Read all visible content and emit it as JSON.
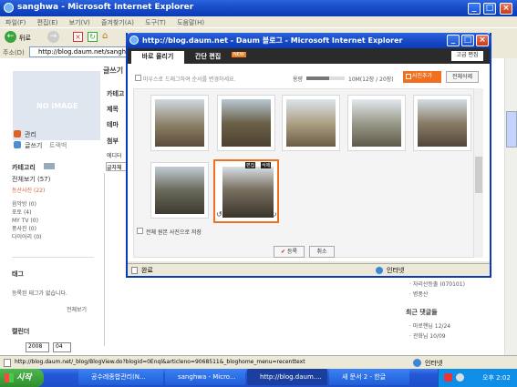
{
  "main_window": {
    "title": "sanghwa - Microsoft Internet Explorer",
    "menu": [
      "파일(F)",
      "편집(E)",
      "보기(V)",
      "즐겨찾기(A)",
      "도구(T)",
      "도움말(H)"
    ],
    "back_label": "뒤로",
    "address_label": "주소(D)",
    "address_value": "http://blog.daum.net/sanghwa",
    "status_url": "http://blog.daum.net/_blog/BlogView.do?blogid=0Enql&articleno=9068511&_bloghome_menu=recenttext",
    "status_zone": "인터넷"
  },
  "blog": {
    "no_image": "NO IMAGE",
    "admin": "관리",
    "write": "글쓰기",
    "trackback": "트랙백",
    "category_title": "카테고리",
    "all_posts": "전체보기 (57)",
    "categories": [
      "등산사진 (22)",
      "음악방 (0)",
      "포토 (4)",
      "MY TV (0)",
      "풍사진 (0)",
      "다이어리 (0)"
    ],
    "tag_title": "태그",
    "tag_empty": "등록된 태그가 없습니다.",
    "view_all": "전체보기",
    "calendar_title": "캘린더",
    "year": "2008",
    "month": "04",
    "post_heading": "글쓰기",
    "form_labels": [
      "카테고",
      "제목",
      "테마",
      "첨부"
    ],
    "editor_tab": "에디터",
    "font_select": "글자체",
    "right_items": [
      "· 자리산등출 (070101)",
      "· 병풍산"
    ],
    "recent_comments": "최근 댓글들",
    "comments": [
      "· 마로핸님 12/24",
      "· 관화님 10/09"
    ]
  },
  "popup": {
    "title": "http://blog.daum.net - Daum 블로그 - Microsoft Internet Explorer",
    "tabs": [
      "바로 올리기",
      "간단 편집"
    ],
    "new_badge": "NEW",
    "advanced_edit": "고급 편집",
    "drag_hint": "마우스로 드래그하여 순서를 변경하세요.",
    "capacity_label": "용량",
    "capacity_text": "10M(12장 / 20장)",
    "capacity_fraction": 0.6,
    "add_photo": "사진추가",
    "delete_all": "전체삭제",
    "selected_tools": [
      "편집",
      "삭제"
    ],
    "save_all_label": "전체 원본 사진으로 저장",
    "register": "등록",
    "cancel": "취소",
    "status_done": "완료",
    "status_zone": "인터넷"
  },
  "taskbar": {
    "start": "시작",
    "items": [
      "공수레종합관리(N...",
      "sanghwa - Micro...",
      "http://blog.daum....",
      "새 문서 2 - 한글"
    ],
    "clock": "오후 2:02"
  }
}
